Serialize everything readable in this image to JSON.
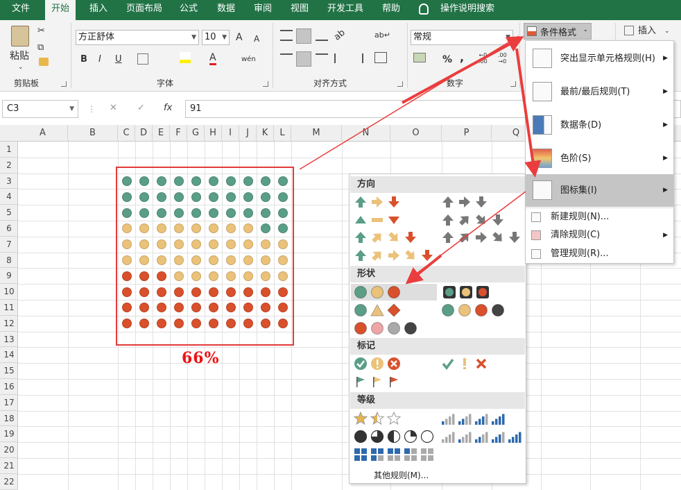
{
  "tabs": [
    "文件",
    "开始",
    "插入",
    "页面布局",
    "公式",
    "数据",
    "审阅",
    "视图",
    "开发工具",
    "帮助",
    "操作说明搜索"
  ],
  "ribbon": {
    "paste_label": "粘贴",
    "clipboard_label": "剪贴板",
    "font_name": "方正舒体",
    "font_size": "10",
    "font_group_label": "字体",
    "align_group_label": "对齐方式",
    "number_format": "常规",
    "number_group_label": "数字",
    "cond_format_label": "条件格式",
    "insert_label": "插入",
    "grow_font": "A",
    "shrink_font": "A",
    "bold": "B",
    "italic": "I",
    "underline": "U",
    "font_color": "A",
    "phonetic": "wén",
    "percent": "%",
    "comma": ","
  },
  "formula": {
    "name_box": "C3",
    "fx": "fx",
    "value": "91"
  },
  "columns": [
    "A",
    "B",
    "C",
    "D",
    "E",
    "F",
    "G",
    "H",
    "I",
    "J",
    "K",
    "L",
    "M",
    "N",
    "O",
    "P",
    "Q"
  ],
  "rows": [
    "1",
    "2",
    "3",
    "4",
    "5",
    "6",
    "7",
    "8",
    "9",
    "10",
    "11",
    "12",
    "13",
    "14",
    "15",
    "16",
    "17",
    "18",
    "19",
    "20",
    "21",
    "22"
  ],
  "colors": {
    "green": "#5a9e86",
    "yellow": "#ebc27a",
    "red": "#d9502c",
    "ribbon_green": "#217346",
    "highlight": "#e23a3a"
  },
  "dot_grid": [
    [
      "g",
      "g",
      "g",
      "g",
      "g",
      "g",
      "g",
      "g",
      "g",
      "g"
    ],
    [
      "g",
      "g",
      "g",
      "g",
      "g",
      "g",
      "g",
      "g",
      "g",
      "g"
    ],
    [
      "g",
      "g",
      "g",
      "g",
      "g",
      "g",
      "g",
      "g",
      "g",
      "g"
    ],
    [
      "y",
      "y",
      "y",
      "y",
      "y",
      "y",
      "y",
      "y",
      "g",
      "g"
    ],
    [
      "y",
      "y",
      "y",
      "y",
      "y",
      "y",
      "y",
      "y",
      "y",
      "y"
    ],
    [
      "y",
      "y",
      "y",
      "y",
      "y",
      "y",
      "y",
      "y",
      "y",
      "y"
    ],
    [
      "r",
      "r",
      "r",
      "y",
      "y",
      "y",
      "y",
      "y",
      "y",
      "y"
    ],
    [
      "r",
      "r",
      "r",
      "r",
      "r",
      "r",
      "r",
      "r",
      "r",
      "r"
    ],
    [
      "r",
      "r",
      "r",
      "r",
      "r",
      "r",
      "r",
      "r",
      "r",
      "r"
    ],
    [
      "r",
      "r",
      "r",
      "r",
      "r",
      "r",
      "r",
      "r",
      "r",
      "r"
    ]
  ],
  "percent_label": "66%",
  "cf_menu": {
    "items": [
      "突出显示单元格规则(H)",
      "最前/最后规则(T)",
      "数据条(D)",
      "色阶(S)",
      "图标集(I)"
    ],
    "small_items": [
      "新建规则(N)...",
      "清除规则(C)",
      "管理规则(R)..."
    ]
  },
  "icon_menu": {
    "sections": [
      "方向",
      "形状",
      "标记",
      "等级"
    ],
    "more_rules": "其他规则(M)..."
  }
}
